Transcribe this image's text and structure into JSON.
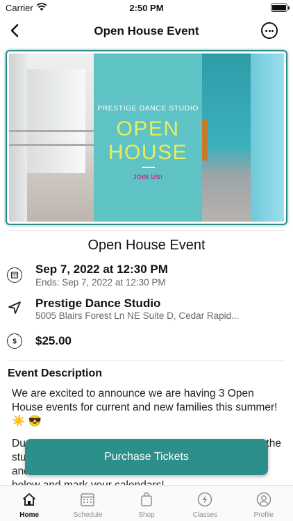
{
  "status_bar": {
    "carrier": "Carrier",
    "time": "2:50 PM"
  },
  "nav": {
    "title": "Open House Event",
    "back_icon": "chevron-left-icon",
    "more_icon": "ellipsis-circle-icon"
  },
  "hero": {
    "studio": "PRESTIGE DANCE STUDIO",
    "headline_1": "OPEN",
    "headline_2": "HOUSE",
    "tagline": "JOIN US!",
    "colors": {
      "border": "#2a8c8a",
      "panel": "#5fc3c6",
      "headline": "#e6ef5a",
      "tagline": "#b4338d"
    }
  },
  "event": {
    "title": "Open House Event",
    "date": "Sep 7, 2022 at 12:30 PM",
    "ends": "Ends: Sep 7, 2022 at 12:30 PM",
    "location_name": "Prestige Dance Studio",
    "location_address": "5005 Blairs Forest Ln NE Suite D, Cedar Rapid...",
    "price": "$25.00",
    "icons": [
      "calendar-icon",
      "location-arrow-icon",
      "dollar-icon"
    ]
  },
  "description": {
    "header": "Event Description",
    "paragraph_1_line_1": "We are excited to announce we are having 3 Open",
    "paragraph_1_line_2": "House events for current and new families this summer!",
    "paragraph_1_line_3": "☀️ 😎",
    "paragraph_2_line_1_start": "Du",
    "paragraph_2_line_1_end": "the",
    "paragraph_2_line_2": "stu",
    "paragraph_2_line_3": "and",
    "paragraph_2_line_4": "below and mark your calendars!"
  },
  "purchase_button": {
    "label": "Purchase Tickets",
    "color": "#2d8f8a"
  },
  "tabs": [
    {
      "label": "Home",
      "icon": "home-icon",
      "active": true
    },
    {
      "label": "Schedule",
      "icon": "calendar-icon",
      "active": false
    },
    {
      "label": "Shop",
      "icon": "shopping-bag-icon",
      "active": false
    },
    {
      "label": "Classes",
      "icon": "bolt-icon",
      "active": false
    },
    {
      "label": "Profile",
      "icon": "person-circle-icon",
      "active": false
    }
  ]
}
